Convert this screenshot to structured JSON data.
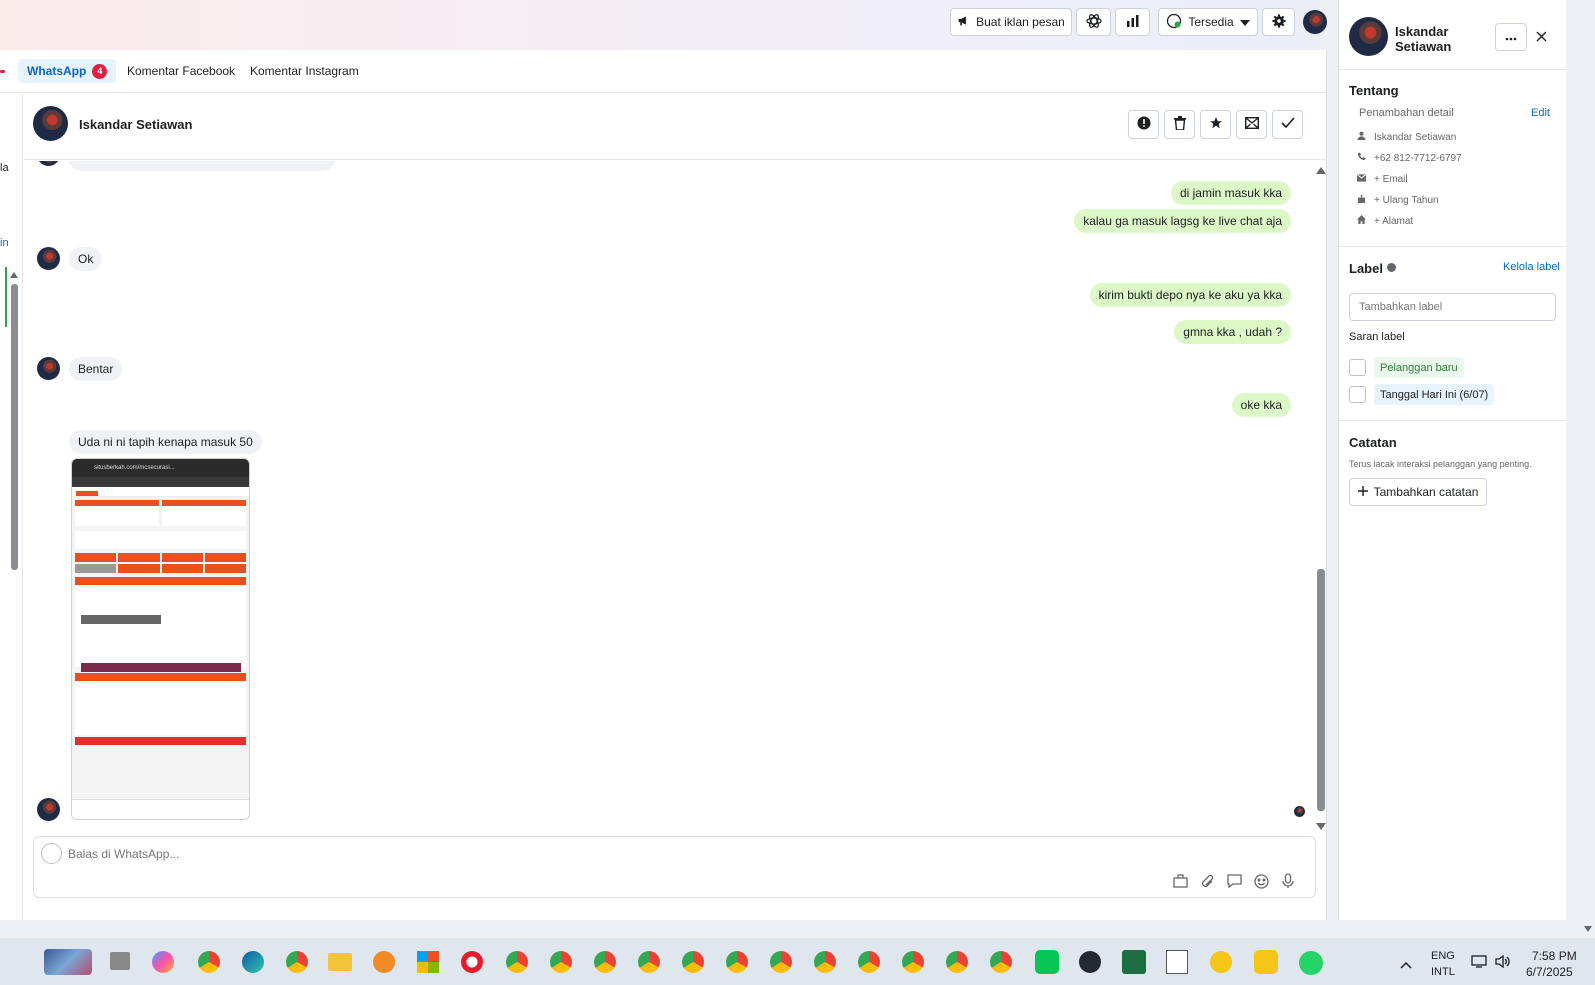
{
  "header": {
    "create_ad_label": "Buat iklan pesan",
    "status_label": "Tersedia"
  },
  "tabs": [
    {
      "label": "WhatsApp",
      "badge": "4"
    },
    {
      "label": "Komentar Facebook"
    },
    {
      "label": "Komentar Instagram"
    }
  ],
  "left_strip": {
    "a": "la",
    "b": "in"
  },
  "chat": {
    "contact_name": "Iskandar Setiawan",
    "messages": [
      {
        "dir": "out",
        "text": "di jamin masuk kka"
      },
      {
        "dir": "out",
        "text": "kalau ga masuk lagsg ke live chat aja"
      },
      {
        "dir": "in",
        "text": "Ok"
      },
      {
        "dir": "out",
        "text": "kirim bukti depo nya ke aku ya kka"
      },
      {
        "dir": "out",
        "text": "gmna kka , udah ?"
      },
      {
        "dir": "in",
        "text": "Bentar"
      },
      {
        "dir": "out",
        "text": "oke kka"
      },
      {
        "dir": "in",
        "text": "Uda ni ni tapih kenapa masuk 50"
      }
    ],
    "attachment_url_text": "situsberkah.com/mcsecurasi...",
    "reply_placeholder": "Balas di WhatsApp..."
  },
  "profile": {
    "name_line1": "Iskandar",
    "name_line2": "Setiawan",
    "about_title": "Tentang",
    "add_detail_label": "Penambahan detail",
    "edit_label": "Edit",
    "details": [
      {
        "icon": "person-icon",
        "text": "Iskandar Setiawan"
      },
      {
        "icon": "phone-icon",
        "text": "+62 812-7712-6797"
      },
      {
        "icon": "email-icon",
        "text": "+ Email"
      },
      {
        "icon": "cake-icon",
        "text": "+ Ulang Tahun"
      },
      {
        "icon": "home-icon",
        "text": "+ Alamat"
      }
    ],
    "label_title": "Label",
    "manage_label": "Kelola label",
    "label_placeholder": "Tambahkan label",
    "suggest_title": "Saran label",
    "suggestions": [
      "Pelanggan baru",
      "Tanggal Hari Ini (6/07)"
    ],
    "notes_title": "Catatan",
    "notes_desc": "Terus lacak interaksi pelanggan yang penting.",
    "add_note_label": "Tambahkan catatan"
  },
  "taskbar": {
    "lang_line1": "ENG",
    "lang_line2": "INTL",
    "time": "7:58 PM",
    "date": "6/7/2025"
  },
  "colors": {
    "accent": "#0a66c2",
    "outgoing_bubble": "#dcf8c6",
    "incoming_bubble": "#f0f2f5",
    "badge": "#e41e3f"
  }
}
